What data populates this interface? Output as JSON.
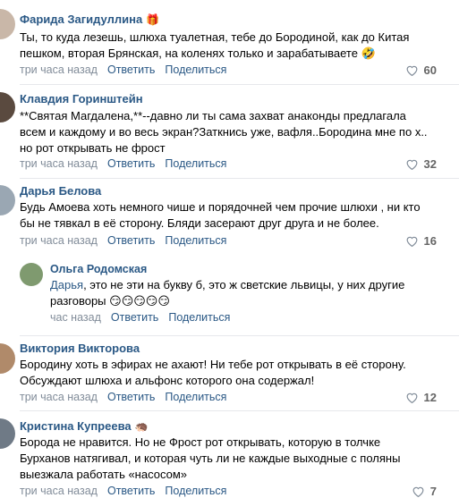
{
  "comments": [
    {
      "author": "Фарида Загидуллина",
      "author_emoji": "🎁",
      "lines": [
        "Ты, то куда лезешь, шлюха туалетная, тебе до Бородиной, как до Китая",
        "пешком, вторая Брянская, на коленях только и зарабатываете 🤣"
      ],
      "time": "три часа назад",
      "reply_label": "Ответить",
      "share_label": "Поделиться",
      "likes": "60",
      "avatar_color": "#c9b7a8"
    },
    {
      "author": "Клавдия Горинштейн",
      "lines": [
        "**Святая Магдалена,**--давно ли ты сама захват анаконды предлагала",
        "всем и каждому и во весь экран?Заткнись уже, вафля..Бородина мне по х..",
        "но рот открывать не фрост"
      ],
      "time": "три часа назад",
      "reply_label": "Ответить",
      "share_label": "Поделиться",
      "likes": "32",
      "avatar_color": "#5a4a3f"
    },
    {
      "author": "Дарья Белова",
      "lines": [
        "Будь Амоева хоть немного чише и порядочней чем прочие шлюхи , ни кто",
        "бы не тявкал в её сторону. Бляди засерают друг друга и не более."
      ],
      "time": "три часа назад",
      "reply_label": "Ответить",
      "share_label": "Поделиться",
      "likes": "16",
      "avatar_color": "#9aa7b3"
    },
    {
      "author": "Ольга Родомская",
      "mention": "Дарья",
      "lines": [
        ", это не эти на букву б, это ж светские львицы, у них другие",
        "разговоры 😏😏😏😏😏"
      ],
      "time": "час назад",
      "reply_label": "Ответить",
      "share_label": "Поделиться",
      "avatar_color": "#7f9a6f"
    },
    {
      "author": "Виктория Викторова",
      "lines": [
        "Бородину хоть в эфирах не ахают! Ни тебе рот открывать в её сторону.",
        "Обсуждают шлюха и альфонс которого она содержал!"
      ],
      "time": "три часа назад",
      "reply_label": "Ответить",
      "share_label": "Поделиться",
      "likes": "12",
      "avatar_color": "#b08a6a"
    },
    {
      "author": "Кристина Купреева",
      "author_emoji": "🦔",
      "lines": [
        "Борода не нравится. Но не Фрост рот открывать, которую в толчке",
        "Бурханов натягивал, и которая чуть ли не каждые выходные с поляны",
        "выезжала работать «насосом»"
      ],
      "time": "три часа назад",
      "reply_label": "Ответить",
      "share_label": "Поделиться",
      "likes": "7",
      "avatar_color": "#6f7a86"
    }
  ]
}
